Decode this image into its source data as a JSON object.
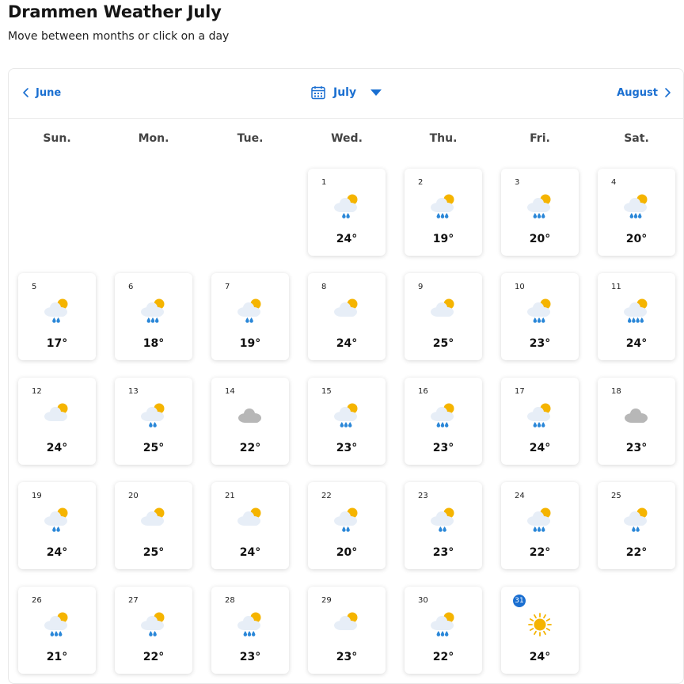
{
  "page": {
    "title": "Drammen Weather July",
    "subtitle": "Move between months or click on a day"
  },
  "nav": {
    "prev_label": "June",
    "current_label": "July",
    "next_label": "August"
  },
  "weekdays": [
    "Sun.",
    "Mon.",
    "Tue.",
    "Wed.",
    "Thu.",
    "Fri.",
    "Sat."
  ],
  "first_weekday_index": 3,
  "today": 31,
  "colors": {
    "accent": "#1a6fd1",
    "sun": "#f5b400",
    "cloud": "#e7eef7",
    "overcast": "#b7b7b7",
    "rain": "#2a87d8"
  },
  "days": [
    {
      "day": "1",
      "icon": "partly-cloudy-rain-2-icon",
      "temp": "24°"
    },
    {
      "day": "2",
      "icon": "partly-cloudy-rain-3-icon",
      "temp": "19°"
    },
    {
      "day": "3",
      "icon": "partly-cloudy-rain-3-icon",
      "temp": "20°"
    },
    {
      "day": "4",
      "icon": "partly-cloudy-rain-3-icon",
      "temp": "20°"
    },
    {
      "day": "5",
      "icon": "partly-cloudy-rain-2-icon",
      "temp": "17°"
    },
    {
      "day": "6",
      "icon": "partly-cloudy-rain-3-icon",
      "temp": "18°"
    },
    {
      "day": "7",
      "icon": "partly-cloudy-rain-2-icon",
      "temp": "19°"
    },
    {
      "day": "8",
      "icon": "partly-cloudy-icon",
      "temp": "24°"
    },
    {
      "day": "9",
      "icon": "partly-cloudy-icon",
      "temp": "25°"
    },
    {
      "day": "10",
      "icon": "partly-cloudy-rain-3-icon",
      "temp": "23°"
    },
    {
      "day": "11",
      "icon": "partly-cloudy-rain-4-icon",
      "temp": "24°"
    },
    {
      "day": "12",
      "icon": "partly-cloudy-icon",
      "temp": "24°"
    },
    {
      "day": "13",
      "icon": "partly-cloudy-rain-2-icon",
      "temp": "25°"
    },
    {
      "day": "14",
      "icon": "overcast-icon",
      "temp": "22°"
    },
    {
      "day": "15",
      "icon": "partly-cloudy-rain-3-icon",
      "temp": "23°"
    },
    {
      "day": "16",
      "icon": "partly-cloudy-rain-3-icon",
      "temp": "23°"
    },
    {
      "day": "17",
      "icon": "partly-cloudy-rain-3-icon",
      "temp": "24°"
    },
    {
      "day": "18",
      "icon": "overcast-icon",
      "temp": "23°"
    },
    {
      "day": "19",
      "icon": "partly-cloudy-rain-2-icon",
      "temp": "24°"
    },
    {
      "day": "20",
      "icon": "partly-cloudy-icon",
      "temp": "25°"
    },
    {
      "day": "21",
      "icon": "partly-cloudy-icon",
      "temp": "24°"
    },
    {
      "day": "22",
      "icon": "partly-cloudy-rain-2-icon",
      "temp": "20°"
    },
    {
      "day": "23",
      "icon": "partly-cloudy-rain-2-icon",
      "temp": "23°"
    },
    {
      "day": "24",
      "icon": "partly-cloudy-rain-3-icon",
      "temp": "22°"
    },
    {
      "day": "25",
      "icon": "partly-cloudy-rain-2-icon",
      "temp": "22°"
    },
    {
      "day": "26",
      "icon": "partly-cloudy-rain-3-icon",
      "temp": "21°"
    },
    {
      "day": "27",
      "icon": "partly-cloudy-rain-2-icon",
      "temp": "22°"
    },
    {
      "day": "28",
      "icon": "partly-cloudy-rain-3-icon",
      "temp": "23°"
    },
    {
      "day": "29",
      "icon": "partly-cloudy-icon",
      "temp": "23°"
    },
    {
      "day": "30",
      "icon": "partly-cloudy-rain-3-icon",
      "temp": "22°"
    },
    {
      "day": "31",
      "icon": "sunny-icon",
      "temp": "24°"
    }
  ]
}
